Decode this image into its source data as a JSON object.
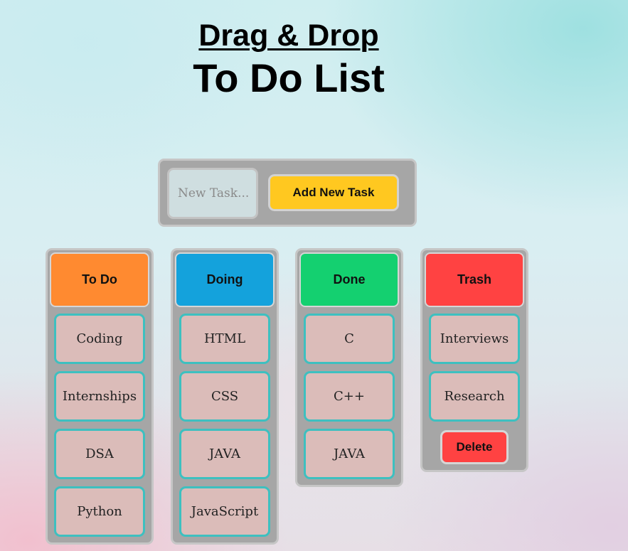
{
  "header": {
    "title_line1": "Drag & Drop",
    "title_line2": "To Do List"
  },
  "add_task": {
    "input_value": "",
    "input_placeholder": "New Task...",
    "button_label": "Add New Task",
    "button_color": "#ffc820"
  },
  "columns": [
    {
      "title": "To Do",
      "color": "#ff8a30",
      "cards": [
        "Coding",
        "Internships",
        "DSA",
        "Python"
      ]
    },
    {
      "title": "Doing",
      "color": "#14a2dc",
      "cards": [
        "HTML",
        "CSS",
        "JAVA",
        "JavaScript"
      ]
    },
    {
      "title": "Done",
      "color": "#14d070",
      "cards": [
        "C",
        "C++",
        "JAVA"
      ]
    },
    {
      "title": "Trash",
      "color": "#ff4242",
      "cards": [
        "Interviews",
        "Research"
      ],
      "delete_label": "Delete"
    }
  ],
  "colors": {
    "panel": "#a6a6a6",
    "card_bg": "#dbbcb9",
    "card_border": "#3dc0c0",
    "delete_button": "#ff4242"
  }
}
